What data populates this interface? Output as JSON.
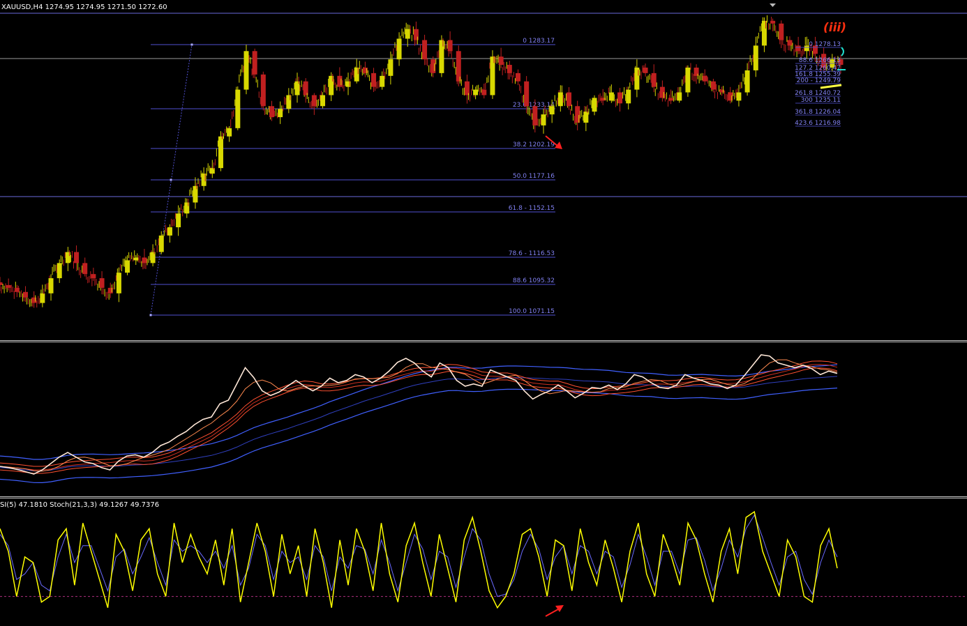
{
  "header": {
    "symbol_line": "XAUUSD,H4  1274.95 1274.95 1271.50 1272.60",
    "oscillator_line": "SI(5) 47.1810   Stoch(21,3,3) 49.1267 49.7376"
  },
  "wave_label": "(iii)",
  "fib_retracement": [
    {
      "label": "0 1283.17",
      "level": 0,
      "price": 1283.17
    },
    {
      "label": "23.6 1233.14",
      "level": 23.6,
      "price": 1233.14
    },
    {
      "label": "38.2 1202.19",
      "level": 38.2,
      "price": 1202.19
    },
    {
      "label": "50.0 1177.16",
      "level": 50.0,
      "price": 1177.16
    },
    {
      "label": "61.8 - 1152.15",
      "level": 61.8,
      "price": 1152.15
    },
    {
      "label": "78.6 - 1116.53",
      "level": 78.6,
      "price": 1116.53
    },
    {
      "label": "88.6 1095.32",
      "level": 88.6,
      "price": 1095.32
    },
    {
      "label": "100.0 1071.15",
      "level": 100.0,
      "price": 1071.15
    }
  ],
  "fib_extension": [
    {
      "label": "0 1278.13",
      "price": 1278.13
    },
    {
      "label": "88.6 1266.13",
      "price": 1266.13
    },
    {
      "label": "127.2 1260.47",
      "price": 1260.47
    },
    {
      "label": "161.8 1255.39",
      "price": 1255.39
    },
    {
      "label": "200 - 1249.79",
      "price": 1249.79
    },
    {
      "label": "261.8 1240.72",
      "price": 1240.72
    },
    {
      "label": "300 1235.11",
      "price": 1235.11
    },
    {
      "label": "361.8 1226.04",
      "price": 1226.04
    },
    {
      "label": "423.6 1216.98",
      "price": 1216.98
    }
  ],
  "colors": {
    "background": "#000000",
    "fib": "#5050d0",
    "fib_text": "#8080f0",
    "bull_candle": "#d8d800",
    "bear_candle": "#c02020",
    "arrow": "#ff2020",
    "stoch_main": "#ffff00",
    "stoch_signal": "#6a6aff",
    "wave_label": "#ff3010"
  },
  "chart_data": [
    {
      "type": "line",
      "title": "XAUUSD,H4",
      "xlabel": "",
      "ylabel": "",
      "ylim": [
        1055,
        1290
      ],
      "grid": false,
      "series": [
        {
          "values": [
            1092,
            1090,
            1087,
            1083,
            1079,
            1086,
            1097,
            1108,
            1116,
            1108,
            1100,
            1097,
            1090,
            1086,
            1101,
            1110,
            1112,
            1108,
            1116,
            1128,
            1134,
            1144,
            1152,
            1164,
            1173,
            1177,
            1200,
            1206,
            1234,
            1262,
            1245,
            1222,
            1214,
            1220,
            1230,
            1240,
            1230,
            1222,
            1230,
            1244,
            1236,
            1240,
            1250,
            1246,
            1236,
            1244,
            1256,
            1271,
            1278,
            1270,
            1256,
            1246,
            1270,
            1262,
            1240,
            1230,
            1234,
            1230,
            1258,
            1252,
            1246,
            1240,
            1222,
            1208,
            1216,
            1222,
            1232,
            1222,
            1210,
            1218,
            1228,
            1226,
            1232,
            1224,
            1234,
            1250,
            1246,
            1236,
            1228,
            1226,
            1232,
            1250,
            1244,
            1240,
            1234,
            1232,
            1226,
            1232,
            1248,
            1266,
            1284,
            1282,
            1270,
            1266,
            1262,
            1266,
            1260,
            1250,
            1256,
            1252
          ]
        }
      ]
    },
    {
      "type": "line",
      "title": "",
      "xlabel": "",
      "ylabel": "",
      "ylim": [
        0,
        100
      ],
      "grid": false,
      "series": [
        {
          "values": [
            80,
            60,
            20,
            55,
            50,
            15,
            20,
            70,
            80,
            30,
            85,
            60,
            35,
            10,
            75,
            60,
            25,
            70,
            80,
            40,
            20,
            85,
            50,
            75,
            55,
            40,
            70,
            30,
            80,
            15,
            50,
            85,
            60,
            20,
            75,
            40,
            65,
            20,
            80,
            50,
            10,
            70,
            30,
            80,
            60,
            25,
            85,
            40,
            15,
            65,
            85,
            50,
            20,
            75,
            45,
            15,
            70,
            90,
            60,
            25,
            10,
            20,
            40,
            75,
            80,
            55,
            20,
            70,
            65,
            25,
            80,
            50,
            30,
            70,
            45,
            15,
            60,
            85,
            40,
            20,
            75,
            55,
            30,
            85,
            70,
            40,
            15,
            60,
            80,
            40,
            90,
            95,
            60,
            40,
            20,
            70,
            55,
            20,
            15,
            65,
            80,
            45
          ]
        },
        {
          "values": [
            75,
            65,
            35,
            40,
            50,
            30,
            25,
            55,
            75,
            50,
            65,
            65,
            45,
            25,
            55,
            62,
            40,
            55,
            72,
            50,
            30,
            70,
            60,
            65,
            60,
            50,
            60,
            45,
            65,
            30,
            45,
            75,
            65,
            35,
            60,
            50,
            55,
            35,
            65,
            55,
            25,
            55,
            45,
            65,
            62,
            40,
            70,
            50,
            25,
            50,
            75,
            62,
            35,
            60,
            55,
            28,
            55,
            80,
            70,
            40,
            20,
            22,
            35,
            60,
            75,
            62,
            35,
            55,
            65,
            40,
            65,
            60,
            40,
            60,
            55,
            28,
            48,
            75,
            55,
            30,
            60,
            60,
            40,
            70,
            72,
            52,
            25,
            45,
            70,
            55,
            80,
            92,
            72,
            50,
            30,
            55,
            60,
            35,
            22,
            50,
            70,
            55
          ]
        }
      ]
    }
  ]
}
